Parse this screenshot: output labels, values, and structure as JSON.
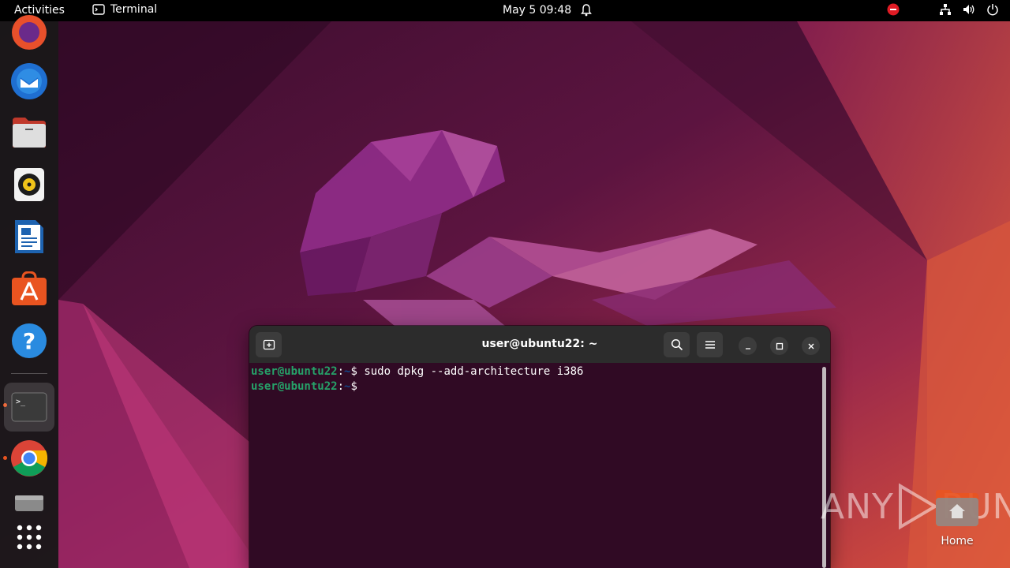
{
  "topbar": {
    "activities": "Activities",
    "app_name": "Terminal",
    "clock": "May 5  09:48"
  },
  "dock": {
    "items": [
      {
        "name": "firefox"
      },
      {
        "name": "thunderbird"
      },
      {
        "name": "files"
      },
      {
        "name": "rhythmbox"
      },
      {
        "name": "libreoffice-writer"
      },
      {
        "name": "ubuntu-software"
      },
      {
        "name": "help"
      },
      {
        "name": "terminal",
        "active": true,
        "running": true
      },
      {
        "name": "google-chrome",
        "running": true
      },
      {
        "name": "disk-drive"
      },
      {
        "name": "show-applications"
      }
    ]
  },
  "terminal": {
    "title": "user@ubuntu22: ~",
    "lines": [
      {
        "user": "user@ubuntu22",
        "sep": ":",
        "path": "~",
        "symbol": "$",
        "command": " sudo dpkg --add-architecture i386"
      },
      {
        "user": "user@ubuntu22",
        "sep": ":",
        "path": "~",
        "symbol": "$",
        "command": " "
      }
    ]
  },
  "desktop": {
    "home_label": "Home"
  },
  "watermark": {
    "left": "ANY",
    "right": "RUN"
  },
  "colors": {
    "accent": "#e95420",
    "terminal_bg": "#300a24",
    "prompt_user": "#26a269",
    "prompt_path": "#12488b"
  }
}
